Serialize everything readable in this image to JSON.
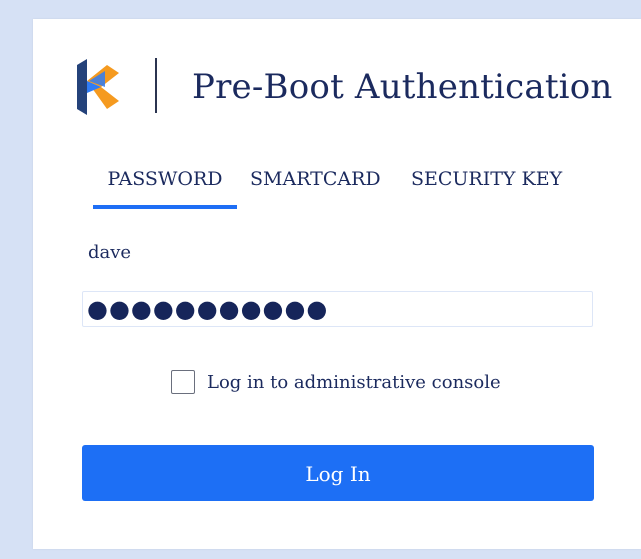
{
  "header": {
    "title": "Pre-Boot Authentication",
    "logo_icon": "k-logo-icon"
  },
  "tabs": [
    {
      "label": "PASSWORD",
      "active": true
    },
    {
      "label": "SMARTCARD",
      "active": false
    },
    {
      "label": "SECURITY KEY",
      "active": false
    }
  ],
  "form": {
    "username": "dave",
    "password_value": "●●●●●●●●●●●",
    "admin_console_label": "Log in to administrative console",
    "admin_console_checked": false,
    "login_label": "Log In"
  },
  "colors": {
    "background": "#d6e1f5",
    "accent": "#1d6ff5",
    "text": "#1b2a5e",
    "logo_orange": "#f59a1f",
    "logo_blue": "#24427a"
  }
}
